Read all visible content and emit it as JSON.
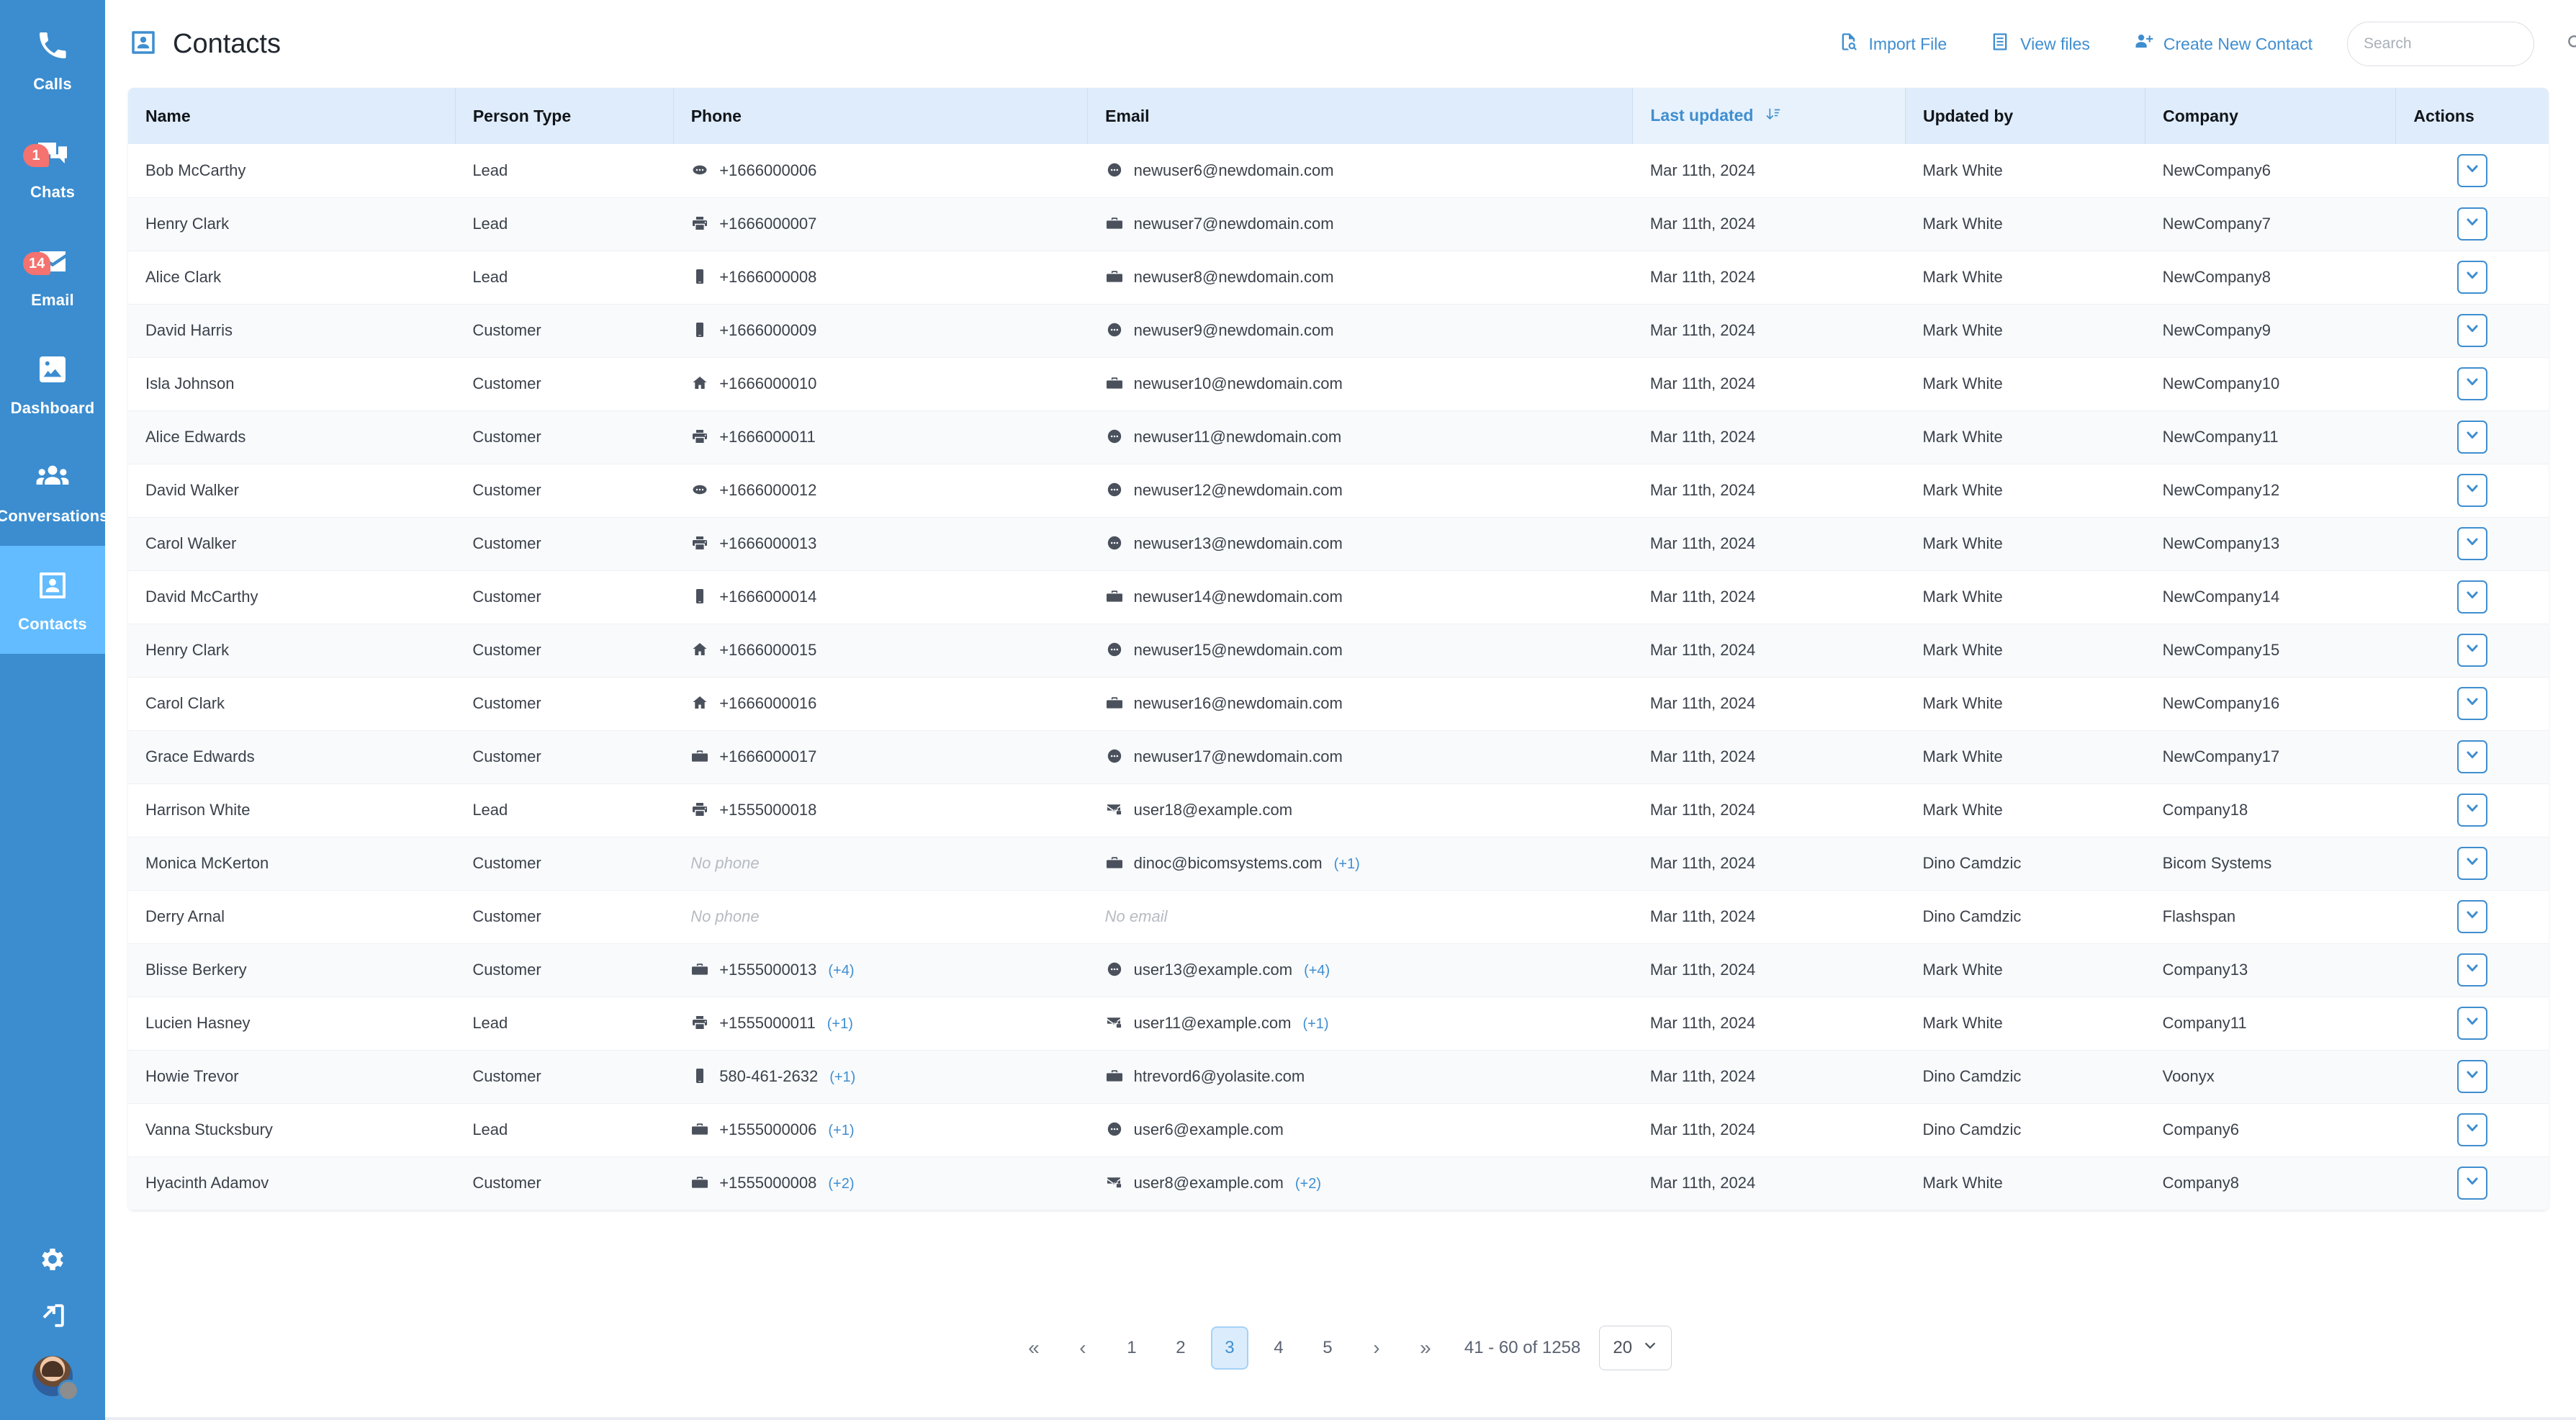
{
  "sidebar": {
    "items": [
      {
        "label": "Calls",
        "icon": "phone-icon",
        "badge": null,
        "active": false
      },
      {
        "label": "Chats",
        "icon": "chat-icon",
        "badge": "1",
        "active": false
      },
      {
        "label": "Email",
        "icon": "envelope-icon",
        "badge": "14",
        "active": false
      },
      {
        "label": "Dashboard",
        "icon": "dashboard-icon",
        "badge": null,
        "active": false
      },
      {
        "label": "Conversations",
        "icon": "people-icon",
        "badge": null,
        "active": false
      },
      {
        "label": "Contacts",
        "icon": "contact-card-icon",
        "badge": null,
        "active": true
      }
    ],
    "bottom": [
      {
        "name": "settings",
        "icon": "gear-icon"
      },
      {
        "name": "logout",
        "icon": "logout-icon"
      }
    ],
    "accent": "#3b8dd0",
    "active_bg": "#63bcff",
    "badge_color": "#f4726f"
  },
  "header": {
    "title": "Contacts",
    "title_icon": "contact-card-icon",
    "actions": [
      {
        "label": "Import File",
        "icon": "import-file-icon"
      },
      {
        "label": "View files",
        "icon": "list-file-icon"
      },
      {
        "label": "Create New Contact",
        "icon": "add-user-icon"
      }
    ],
    "search": {
      "placeholder": "Search",
      "value": ""
    }
  },
  "table": {
    "columns": [
      {
        "label": "Name",
        "sorted": false
      },
      {
        "label": "Person Type",
        "sorted": false
      },
      {
        "label": "Phone",
        "sorted": false
      },
      {
        "label": "Email",
        "sorted": false
      },
      {
        "label": "Last updated",
        "sorted": true
      },
      {
        "label": "Updated by",
        "sorted": false
      },
      {
        "label": "Company",
        "sorted": false
      },
      {
        "label": "Actions",
        "sorted": false
      }
    ],
    "empty_phone_label": "No phone",
    "empty_email_label": "No email",
    "rows": [
      {
        "name": "Bob McCarthy",
        "type": "Lead",
        "phone": "+1666000006",
        "phone_icon": "other-phone-icon",
        "phone_more": "",
        "email": "newuser6@newdomain.com",
        "email_icon": "other-email-icon",
        "email_more": "",
        "updated": "Mar 11th, 2024",
        "by": "Mark White",
        "company": "NewCompany6"
      },
      {
        "name": "Henry Clark",
        "type": "Lead",
        "phone": "+1666000007",
        "phone_icon": "fax-icon",
        "phone_more": "",
        "email": "newuser7@newdomain.com",
        "email_icon": "work-icon",
        "email_more": "",
        "updated": "Mar 11th, 2024",
        "by": "Mark White",
        "company": "NewCompany7"
      },
      {
        "name": "Alice Clark",
        "type": "Lead",
        "phone": "+1666000008",
        "phone_icon": "mobile-icon",
        "phone_more": "",
        "email": "newuser8@newdomain.com",
        "email_icon": "work-icon",
        "email_more": "",
        "updated": "Mar 11th, 2024",
        "by": "Mark White",
        "company": "NewCompany8"
      },
      {
        "name": "David Harris",
        "type": "Customer",
        "phone": "+1666000009",
        "phone_icon": "mobile-icon",
        "phone_more": "",
        "email": "newuser9@newdomain.com",
        "email_icon": "other-email-icon",
        "email_more": "",
        "updated": "Mar 11th, 2024",
        "by": "Mark White",
        "company": "NewCompany9"
      },
      {
        "name": "Isla Johnson",
        "type": "Customer",
        "phone": "+1666000010",
        "phone_icon": "home-icon",
        "phone_more": "",
        "email": "newuser10@newdomain.com",
        "email_icon": "work-icon",
        "email_more": "",
        "updated": "Mar 11th, 2024",
        "by": "Mark White",
        "company": "NewCompany10"
      },
      {
        "name": "Alice Edwards",
        "type": "Customer",
        "phone": "+1666000011",
        "phone_icon": "fax-icon",
        "phone_more": "",
        "email": "newuser11@newdomain.com",
        "email_icon": "other-email-icon",
        "email_more": "",
        "updated": "Mar 11th, 2024",
        "by": "Mark White",
        "company": "NewCompany11"
      },
      {
        "name": "David Walker",
        "type": "Customer",
        "phone": "+1666000012",
        "phone_icon": "other-phone-icon",
        "phone_more": "",
        "email": "newuser12@newdomain.com",
        "email_icon": "other-email-icon",
        "email_more": "",
        "updated": "Mar 11th, 2024",
        "by": "Mark White",
        "company": "NewCompany12"
      },
      {
        "name": "Carol Walker",
        "type": "Customer",
        "phone": "+1666000013",
        "phone_icon": "fax-icon",
        "phone_more": "",
        "email": "newuser13@newdomain.com",
        "email_icon": "other-email-icon",
        "email_more": "",
        "updated": "Mar 11th, 2024",
        "by": "Mark White",
        "company": "NewCompany13"
      },
      {
        "name": "David McCarthy",
        "type": "Customer",
        "phone": "+1666000014",
        "phone_icon": "mobile-icon",
        "phone_more": "",
        "email": "newuser14@newdomain.com",
        "email_icon": "work-icon",
        "email_more": "",
        "updated": "Mar 11th, 2024",
        "by": "Mark White",
        "company": "NewCompany14"
      },
      {
        "name": "Henry Clark",
        "type": "Customer",
        "phone": "+1666000015",
        "phone_icon": "home-icon",
        "phone_more": "",
        "email": "newuser15@newdomain.com",
        "email_icon": "other-email-icon",
        "email_more": "",
        "updated": "Mar 11th, 2024",
        "by": "Mark White",
        "company": "NewCompany15"
      },
      {
        "name": "Carol Clark",
        "type": "Customer",
        "phone": "+1666000016",
        "phone_icon": "home-icon",
        "phone_more": "",
        "email": "newuser16@newdomain.com",
        "email_icon": "work-icon",
        "email_more": "",
        "updated": "Mar 11th, 2024",
        "by": "Mark White",
        "company": "NewCompany16"
      },
      {
        "name": "Grace Edwards",
        "type": "Customer",
        "phone": "+1666000017",
        "phone_icon": "work-icon",
        "phone_more": "",
        "email": "newuser17@newdomain.com",
        "email_icon": "other-email-icon",
        "email_more": "",
        "updated": "Mar 11th, 2024",
        "by": "Mark White",
        "company": "NewCompany17"
      },
      {
        "name": "Harrison White",
        "type": "Lead",
        "phone": "+1555000018",
        "phone_icon": "fax-icon",
        "phone_more": "",
        "email": "user18@example.com",
        "email_icon": "mail-lock-icon",
        "email_more": "",
        "updated": "Mar 11th, 2024",
        "by": "Mark White",
        "company": "Company18"
      },
      {
        "name": "Monica McKerton",
        "type": "Customer",
        "phone": "",
        "phone_icon": "",
        "phone_more": "",
        "email": "dinoc@bicomsystems.com",
        "email_icon": "work-icon",
        "email_more": "(+1)",
        "updated": "Mar 11th, 2024",
        "by": "Dino Camdzic",
        "company": "Bicom Systems"
      },
      {
        "name": "Derry Arnal",
        "type": "Customer",
        "phone": "",
        "phone_icon": "",
        "phone_more": "",
        "email": "",
        "email_icon": "",
        "email_more": "",
        "updated": "Mar 11th, 2024",
        "by": "Dino Camdzic",
        "company": "Flashspan"
      },
      {
        "name": "Blisse Berkery",
        "type": "Customer",
        "phone": "+1555000013",
        "phone_icon": "work-icon",
        "phone_more": "(+4)",
        "email": "user13@example.com",
        "email_icon": "other-email-icon",
        "email_more": "(+4)",
        "updated": "Mar 11th, 2024",
        "by": "Mark White",
        "company": "Company13"
      },
      {
        "name": "Lucien Hasney",
        "type": "Lead",
        "phone": "+1555000011",
        "phone_icon": "fax-icon",
        "phone_more": "(+1)",
        "email": "user11@example.com",
        "email_icon": "mail-lock-icon",
        "email_more": "(+1)",
        "updated": "Mar 11th, 2024",
        "by": "Mark White",
        "company": "Company11"
      },
      {
        "name": "Howie Trevor",
        "type": "Customer",
        "phone": "580-461-2632",
        "phone_icon": "mobile-icon",
        "phone_more": "(+1)",
        "email": "htrevord6@yolasite.com",
        "email_icon": "work-icon",
        "email_more": "",
        "updated": "Mar 11th, 2024",
        "by": "Dino Camdzic",
        "company": "Voonyx"
      },
      {
        "name": "Vanna Stucksbury",
        "type": "Lead",
        "phone": "+1555000006",
        "phone_icon": "work-icon",
        "phone_more": "(+1)",
        "email": "user6@example.com",
        "email_icon": "other-email-icon",
        "email_more": "",
        "updated": "Mar 11th, 2024",
        "by": "Dino Camdzic",
        "company": "Company6"
      },
      {
        "name": "Hyacinth Adamov",
        "type": "Customer",
        "phone": "+1555000008",
        "phone_icon": "work-icon",
        "phone_more": "(+2)",
        "email": "user8@example.com",
        "email_icon": "mail-lock-icon",
        "email_more": "(+2)",
        "updated": "Mar 11th, 2024",
        "by": "Mark White",
        "company": "Company8"
      }
    ],
    "row_action_icon": "chevron-down-boxed-icon"
  },
  "pagination": {
    "first_label": "«",
    "prev_label": "‹",
    "pages": [
      "1",
      "2",
      "3",
      "4",
      "5"
    ],
    "current_page": "3",
    "next_label": "›",
    "last_label": "»",
    "range_info": "41 - 60 of 1258",
    "page_size": "20"
  }
}
